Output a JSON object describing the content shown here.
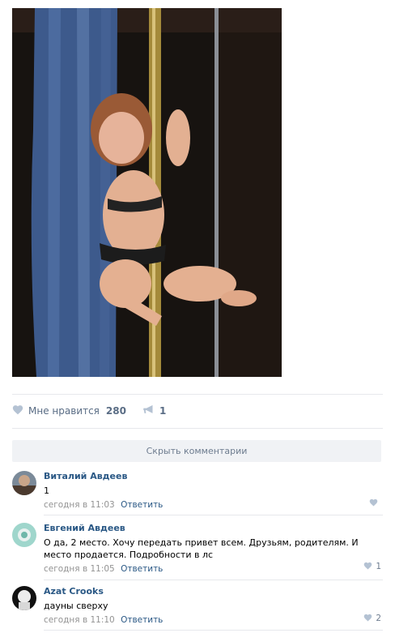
{
  "post": {
    "image_alt": "photo",
    "likes_label": "Мне нравится",
    "likes_count": "280",
    "shares_count": "1"
  },
  "comments_toggle": "Скрыть комментарии",
  "comments": [
    {
      "author": "Виталий Авдеев",
      "text": "1",
      "time": "сегодня в 11:03",
      "reply": "Ответить",
      "likes": ""
    },
    {
      "author": "Евгений Авдеев",
      "text": "О да, 2 место. Хочу передать привет всем. Друзьям, родителям. И место продается. Подробности в лс",
      "time": "сегодня в 11:05",
      "reply": "Ответить",
      "likes": "1"
    },
    {
      "author": "Azat Crooks",
      "text": "дауны сверху",
      "time": "сегодня в 11:10",
      "reply": "Ответить",
      "likes": "2"
    }
  ],
  "colors": {
    "link": "#2a5885",
    "meta": "#939393",
    "action": "#5a6d85",
    "icon": "#b4c2d3"
  },
  "icons": {
    "like": "heart-icon",
    "share": "megaphone-icon"
  }
}
